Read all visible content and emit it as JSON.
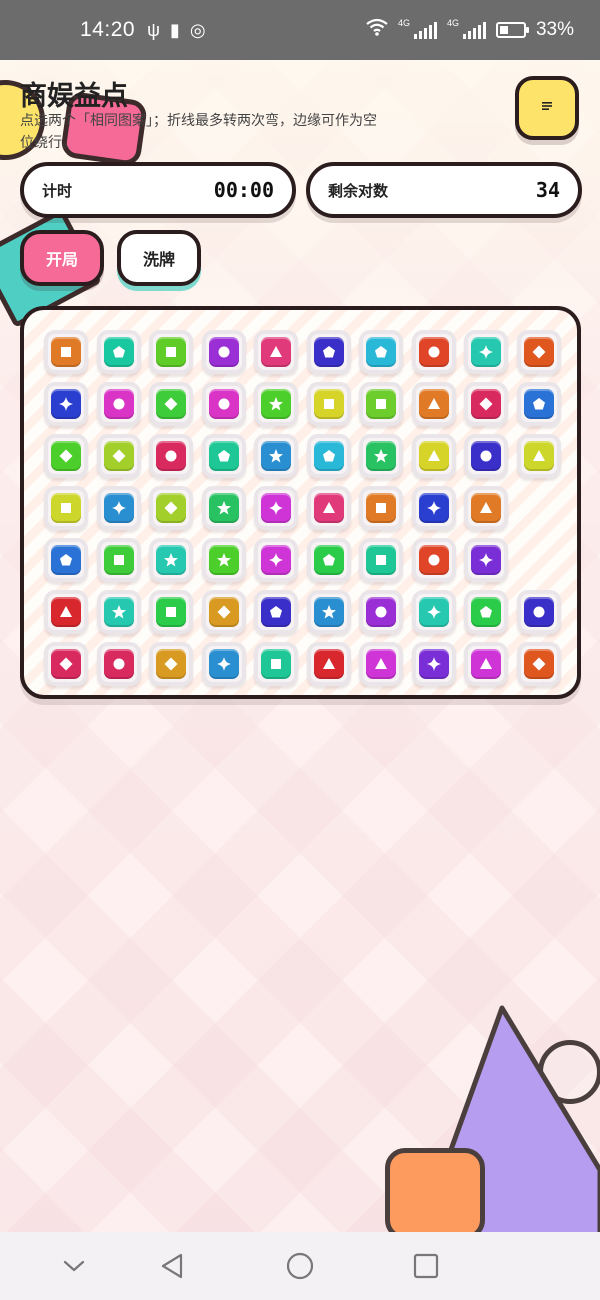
{
  "status_bar": {
    "time": "14:20",
    "left_icons": [
      "usb-icon",
      "battery-saver-icon",
      "wechat-icon"
    ],
    "network_1": "4G",
    "network_2": "4G",
    "battery_percent": "33%"
  },
  "header": {
    "title": "商娱益点",
    "subtitle": "点选两个「相同图案」；折线最多转两次弯，边缘可作为空位绕行。",
    "menu_icon": "menu-lines-icon"
  },
  "stats": {
    "timer_label": "计时",
    "timer_value": "00:00",
    "pairs_label": "剩余对数",
    "pairs_value": "34"
  },
  "controls": {
    "start_label": "开局",
    "shuffle_label": "洗牌"
  },
  "board": {
    "rows": 7,
    "cols": 10,
    "tiles": [
      [
        {
          "c": "#e07a26",
          "s": "square"
        },
        {
          "c": "#19c7a0",
          "s": "pentagon"
        },
        {
          "c": "#5fcc27",
          "s": "square"
        },
        {
          "c": "#9b2fd6",
          "s": "circle"
        },
        {
          "c": "#e03a7a",
          "s": "triangle"
        },
        {
          "c": "#3a2fc8",
          "s": "pentagon"
        },
        {
          "c": "#29b8d8",
          "s": "pentagon"
        },
        {
          "c": "#e04528",
          "s": "circle"
        },
        {
          "c": "#27c8b0",
          "s": "sparkle"
        },
        {
          "c": "#e0561f",
          "s": "diamond"
        }
      ],
      [
        {
          "c": "#2a3fd0",
          "s": "sparkle"
        },
        {
          "c": "#d934c5",
          "s": "circle"
        },
        {
          "c": "#3fcc3a",
          "s": "diamond"
        },
        {
          "c": "#d934c5",
          "s": "circle"
        },
        {
          "c": "#4ccf2a",
          "s": "star"
        },
        {
          "c": "#d6d428",
          "s": "square"
        },
        {
          "c": "#6ccd2c",
          "s": "square"
        },
        {
          "c": "#e07a26",
          "s": "triangle"
        },
        {
          "c": "#d82a5e",
          "s": "diamond"
        },
        {
          "c": "#2a72d6",
          "s": "pentagon"
        }
      ],
      [
        {
          "c": "#4ccf2a",
          "s": "diamond"
        },
        {
          "c": "#a2cf2a",
          "s": "diamond"
        },
        {
          "c": "#d82a5e",
          "s": "circle"
        },
        {
          "c": "#1ec795",
          "s": "pentagon"
        },
        {
          "c": "#2a8fd0",
          "s": "star"
        },
        {
          "c": "#29b8d8",
          "s": "pentagon"
        },
        {
          "c": "#28c262",
          "s": "star"
        },
        {
          "c": "#d6d428",
          "s": "triangle"
        },
        {
          "c": "#3a2fc8",
          "s": "circle"
        },
        {
          "c": "#cdd62a",
          "s": "triangle"
        }
      ],
      [
        {
          "c": "#cdd62a",
          "s": "square"
        },
        {
          "c": "#2a8fd0",
          "s": "sparkle"
        },
        {
          "c": "#a2cf2a",
          "s": "diamond"
        },
        {
          "c": "#28c262",
          "s": "star"
        },
        {
          "c": "#cf35d6",
          "s": "sparkle"
        },
        {
          "c": "#e03a7a",
          "s": "triangle"
        },
        {
          "c": "#e07a26",
          "s": "square"
        },
        {
          "c": "#2a3fd0",
          "s": "sparkle"
        },
        {
          "c": "#e07a26",
          "s": "triangle"
        },
        null
      ],
      [
        {
          "c": "#2a72d6",
          "s": "pentagon"
        },
        {
          "c": "#3fcc3a",
          "s": "square"
        },
        {
          "c": "#27c8b0",
          "s": "star"
        },
        {
          "c": "#4ccf2a",
          "s": "star"
        },
        {
          "c": "#cf35d6",
          "s": "sparkle"
        },
        {
          "c": "#2acc4a",
          "s": "pentagon"
        },
        {
          "c": "#1ec795",
          "s": "square"
        },
        {
          "c": "#e04528",
          "s": "circle"
        },
        {
          "c": "#7a2fd6",
          "s": "sparkle"
        },
        null
      ],
      [
        {
          "c": "#d8282e",
          "s": "triangle"
        },
        {
          "c": "#27c8b0",
          "s": "star"
        },
        {
          "c": "#2acc4a",
          "s": "square"
        },
        {
          "c": "#d89a20",
          "s": "diamond"
        },
        {
          "c": "#3a2fc8",
          "s": "pentagon"
        },
        {
          "c": "#2a8fd0",
          "s": "star"
        },
        {
          "c": "#9b2fd6",
          "s": "circle"
        },
        {
          "c": "#27c8b0",
          "s": "sparkle"
        },
        {
          "c": "#2acc4a",
          "s": "pentagon"
        },
        {
          "c": "#3a2fc8",
          "s": "circle"
        }
      ],
      [
        {
          "c": "#d82a5e",
          "s": "diamond"
        },
        {
          "c": "#d82a5e",
          "s": "circle"
        },
        {
          "c": "#d89a20",
          "s": "diamond"
        },
        {
          "c": "#2a8fd0",
          "s": "sparkle"
        },
        {
          "c": "#1ec795",
          "s": "square"
        },
        {
          "c": "#d8282e",
          "s": "triangle"
        },
        {
          "c": "#cf35d6",
          "s": "triangle"
        },
        {
          "c": "#7a2fd6",
          "s": "sparkle"
        },
        {
          "c": "#cf35d6",
          "s": "triangle"
        },
        {
          "c": "#e0561f",
          "s": "diamond"
        }
      ]
    ]
  },
  "nav": {
    "icons": [
      "chevron-down-icon",
      "back-triangle-icon",
      "home-circle-icon",
      "recents-square-icon"
    ]
  }
}
